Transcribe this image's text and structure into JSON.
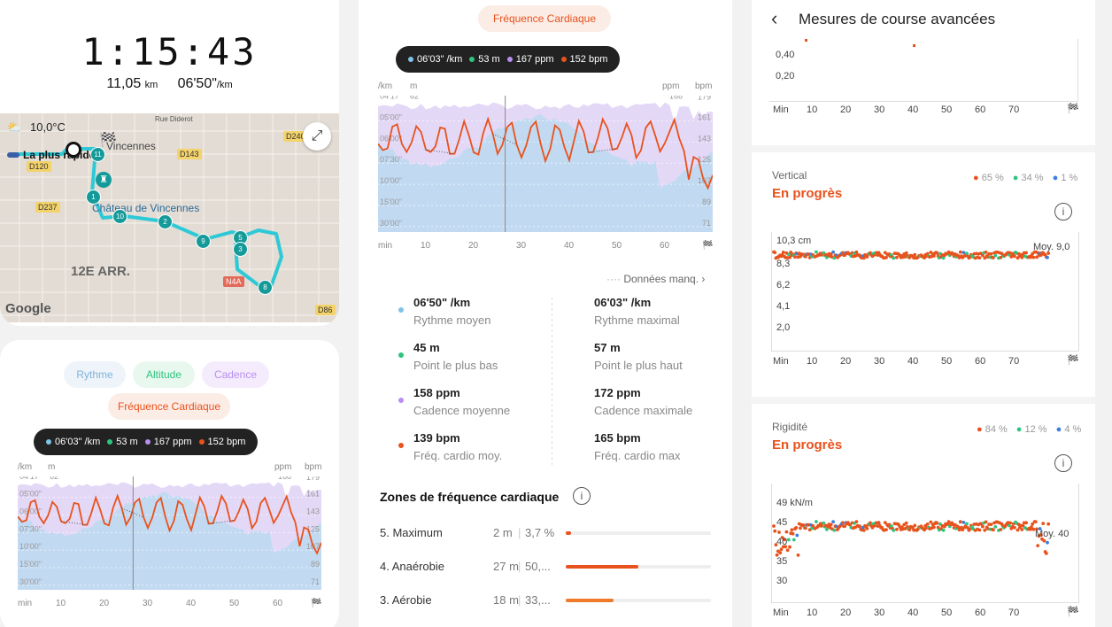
{
  "colors": {
    "pace": "#7fc3e8",
    "altitude": "#2fc47e",
    "cadence": "#b98ef0",
    "heart": "#e8521c",
    "route": "#2ec9d6"
  },
  "summary": {
    "duration": "1:15:43",
    "distance": "11,05",
    "distance_unit": "km",
    "pace": "06'50\"",
    "pace_unit": "/km"
  },
  "map": {
    "temperature": "10,0°C",
    "route_label": "La plus rapide",
    "place_vincennes": "Vincennes",
    "place_chateau": "Château de Vincennes",
    "district": "12E ARR.",
    "street": "Rue Diderot",
    "google": "Google",
    "roads": [
      "D240",
      "D143",
      "D120",
      "D237",
      "N4A",
      "D86"
    ],
    "markers": [
      "11",
      "1",
      "10",
      "2",
      "9",
      "5",
      "3",
      "8"
    ]
  },
  "tabs": {
    "pace": "Rythme",
    "altitude": "Altitude",
    "cadence": "Cadence",
    "heart": "Fréquence Cardiaque"
  },
  "tooltip": {
    "pace": "06'03\" /km",
    "altitude": "53 m",
    "cadence": "167 ppm",
    "heart": "152 bpm"
  },
  "chart_axes": {
    "left_unit_pace": "/km",
    "left_unit_alt": "m",
    "right_unit_cad": "ppm",
    "right_unit_hr": "bpm",
    "pace_ticks": [
      "04'17\"",
      "05'00\"",
      "06'00\"",
      "07'30\"",
      "10'00\"",
      "15'00\"",
      "30'00\""
    ],
    "alt_top": "62",
    "cad_top": "168",
    "hr_ticks": [
      "179",
      "161",
      "143",
      "125",
      "107",
      "89",
      "71"
    ],
    "x_ticks": [
      "min",
      "10",
      "20",
      "30",
      "40",
      "50",
      "60"
    ]
  },
  "missing_data": "Données manq.",
  "stats": [
    {
      "value": "06'50\" /km",
      "label": "Rythme moyen",
      "color": "#7fc3e8"
    },
    {
      "value": "06'03\" /km",
      "label": "Rythme maximal"
    },
    {
      "value": "45 m",
      "label": "Point le plus bas",
      "color": "#2fc47e"
    },
    {
      "value": "57 m",
      "label": "Point le plus haut"
    },
    {
      "value": "158 ppm",
      "label": "Cadence moyenne",
      "color": "#b98ef0"
    },
    {
      "value": "172 ppm",
      "label": "Cadence maximale"
    },
    {
      "value": "139 bpm",
      "label": "Fréq. cardio moy.",
      "color": "#e8521c"
    },
    {
      "value": "165 bpm",
      "label": "Fréq. cardio max"
    }
  ],
  "zones_title": "Zones de fréquence cardiaque",
  "zones": [
    {
      "name": "5. Maximum",
      "time": "2 m",
      "pct": "3,7 %",
      "fill": 0.037
    },
    {
      "name": "4. Anaérobie",
      "time": "27 m",
      "pct": "50,...",
      "fill": 0.5
    },
    {
      "name": "3. Aérobie",
      "time": "18 m",
      "pct": "33,...",
      "fill": 0.33
    }
  ],
  "advanced": {
    "title": "Mesures de course avancées",
    "top_ticks": [
      "0,40",
      "0,20"
    ],
    "x_ticks": [
      "Min",
      "10",
      "20",
      "30",
      "40",
      "50",
      "60",
      "70"
    ],
    "vertical": {
      "name": "Vertical",
      "status": "En progrès",
      "legend": [
        "65 %",
        "34 %",
        "1 %"
      ],
      "y_ticks": [
        "10,3 cm",
        "8,3",
        "6,2",
        "4,1",
        "2,0"
      ],
      "avg": "Moy. 9,0"
    },
    "stiffness": {
      "name": "Rigidité",
      "status": "En progrès",
      "legend": [
        "84 %",
        "12 %",
        "4 %"
      ],
      "y_ticks": [
        "49 kN/m",
        "45",
        "40",
        "35",
        "30"
      ],
      "avg": "Moy. 40"
    }
  }
}
